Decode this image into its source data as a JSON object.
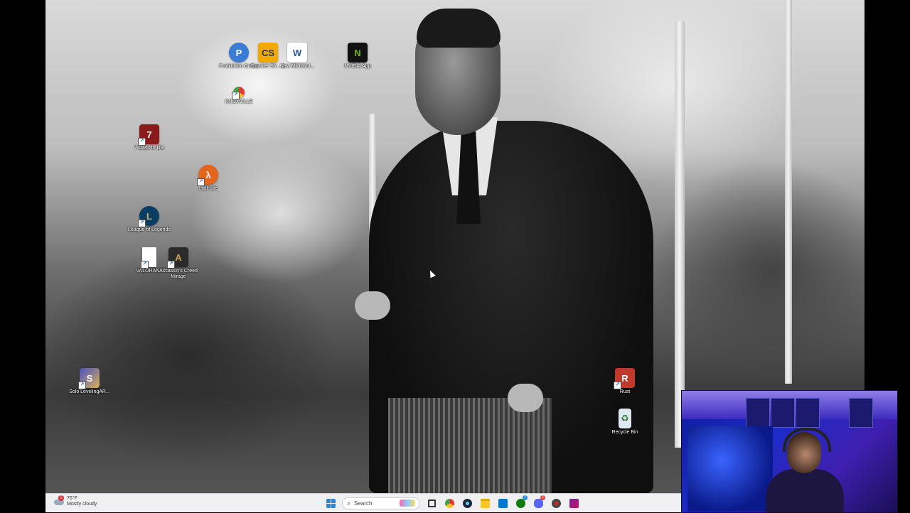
{
  "desktop": {
    "icons": [
      {
        "label": "Prohibition Online",
        "glyph": "P",
        "color": "#3a7bd5"
      },
      {
        "label": "Counter Str... 2",
        "glyph": "CS",
        "color": "#f2a900"
      },
      {
        "label": "New Microsof...",
        "glyph": "W",
        "color": "#2b579a"
      },
      {
        "label": "NVIDIA App",
        "glyph": "N",
        "color": "#76b900"
      },
      {
        "label": "KNOXVILLE",
        "glyph": "G",
        "color": "#ffffff"
      },
      {
        "label": "7 Days to Die",
        "glyph": "7",
        "color": "#8b1a1a"
      },
      {
        "label": "Half-Life",
        "glyph": "λ",
        "color": "#e3641b"
      },
      {
        "label": "League of Legends",
        "glyph": "L",
        "color": "#0a3d62"
      },
      {
        "label": "VALORANT",
        "glyph": "",
        "color": "#ffffff"
      },
      {
        "label": "Assassin's Creed Mirage",
        "glyph": "A",
        "color": "#2b2b2b"
      },
      {
        "label": "Solo LevelingAR...",
        "glyph": "S",
        "color": "#4a4fbf"
      },
      {
        "label": "Rust",
        "glyph": "R",
        "color": "#c0392b"
      },
      {
        "label": "Recycle Bin",
        "glyph": "♻",
        "color": "#dfe8f0"
      }
    ]
  },
  "taskbar": {
    "weather": {
      "badge": "5",
      "temperature": "76°F",
      "condition": "Mostly cloudy"
    },
    "search_placeholder": "Search",
    "apps": [
      {
        "name": "task-view",
        "color": "#333333",
        "badge": ""
      },
      {
        "name": "chrome",
        "color": "#e53935",
        "badge": ""
      },
      {
        "name": "steam",
        "color": "#1b2838",
        "badge": ""
      },
      {
        "name": "file-explorer",
        "color": "#f9c623",
        "badge": ""
      },
      {
        "name": "microsoft-store",
        "color": "#0078d4",
        "badge": ""
      },
      {
        "name": "xbox",
        "color": "#107c10",
        "badge": "1"
      },
      {
        "name": "discord",
        "color": "#5865f2",
        "badge": "2"
      },
      {
        "name": "game-app",
        "color": "#444444",
        "badge": ""
      },
      {
        "name": "media-app",
        "color": "#c2185b",
        "badge": ""
      }
    ]
  }
}
